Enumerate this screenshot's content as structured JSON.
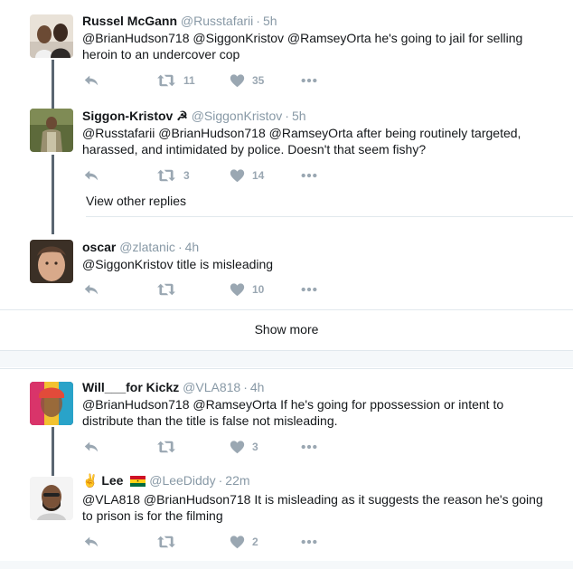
{
  "conversation1": {
    "tweets": [
      {
        "name": "Russel McGann",
        "handle": "@Russtafarii",
        "time": "5h",
        "text": "@BrianHudson718 @SiggonKristov @RamseyOrta he's going to jail for selling heroin to an undercover cop",
        "retweets": "11",
        "likes": "35"
      },
      {
        "name": "Siggon-Kristov",
        "name_emoji": "☭",
        "handle": "@SiggonKristov",
        "time": "5h",
        "text": "@Russtafarii @BrianHudson718 @RamseyOrta after being routinely targeted, harassed, and intimidated by police. Doesn't that seem fishy?",
        "retweets": "3",
        "likes": "14"
      },
      {
        "name": "oscar",
        "handle": "@zlatanic",
        "time": "4h",
        "text": "@SiggonKristov title is misleading",
        "retweets": "",
        "likes": "10"
      }
    ],
    "view_other_replies": "View other replies",
    "show_more": "Show more"
  },
  "conversation2": {
    "tweets": [
      {
        "name": "Will___for Kickz",
        "handle": "@VLA818",
        "time": "4h",
        "text": "@BrianHudson718 @RamseyOrta If he's going for ppossession or intent to distribute than the title is false not misleading.",
        "retweets": "",
        "likes": "3"
      },
      {
        "name_prefix_emoji": "✌",
        "name": "Lee",
        "name_flag": "Ghana flag",
        "handle": "@LeeDiddy",
        "time": "22m",
        "text": "@VLA818 @BrianHudson718 It is misleading as it suggests the reason he's going to prison is for the filming",
        "retweets": "",
        "likes": "2"
      }
    ]
  },
  "separator": "·",
  "icons": {
    "reply": "reply-icon",
    "retweet": "retweet-icon",
    "like": "heart-icon",
    "more": "more-dots-icon"
  },
  "colors": {
    "action_gray": "#9aa7b2",
    "handle_gray": "#8899a6",
    "thread_line": "#5a6671",
    "divider": "#e1e8ed",
    "gap_background": "#f5f8fa"
  }
}
